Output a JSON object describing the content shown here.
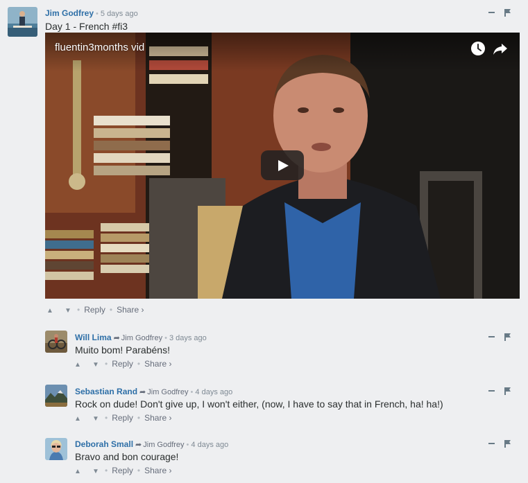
{
  "comments": [
    {
      "author": "Jim Godfrey",
      "time": "5 days ago",
      "text": "Day 1 - French #fi3",
      "reply_label": "Reply",
      "share_label": "Share ›",
      "video": {
        "title": "fluentin3months vid",
        "watch_later_icon": "clock-icon",
        "share_icon": "share-arrow-icon",
        "play_icon": "play-icon"
      }
    },
    {
      "author": "Will Lima",
      "reply_to": "Jim Godfrey",
      "time": "3 days ago",
      "text": "Muito bom! Parabéns!",
      "reply_label": "Reply",
      "share_label": "Share ›"
    },
    {
      "author": "Sebastian Rand",
      "reply_to": "Jim Godfrey",
      "time": "4 days ago",
      "text": "Rock on dude! Don't give up, I won't either, (now, I have to say that in French, ha! ha!)",
      "reply_label": "Reply",
      "share_label": "Share ›"
    },
    {
      "author": "Deborah Small",
      "reply_to": "Jim Godfrey",
      "time": "4 days ago",
      "text": "Bravo and bon courage!",
      "reply_label": "Reply",
      "share_label": "Share ›"
    }
  ],
  "colors": {
    "background": "#eeeff1",
    "author_link": "#2e6fa7",
    "meta_text": "#7f8a94",
    "body_text": "#2a2e2e"
  }
}
